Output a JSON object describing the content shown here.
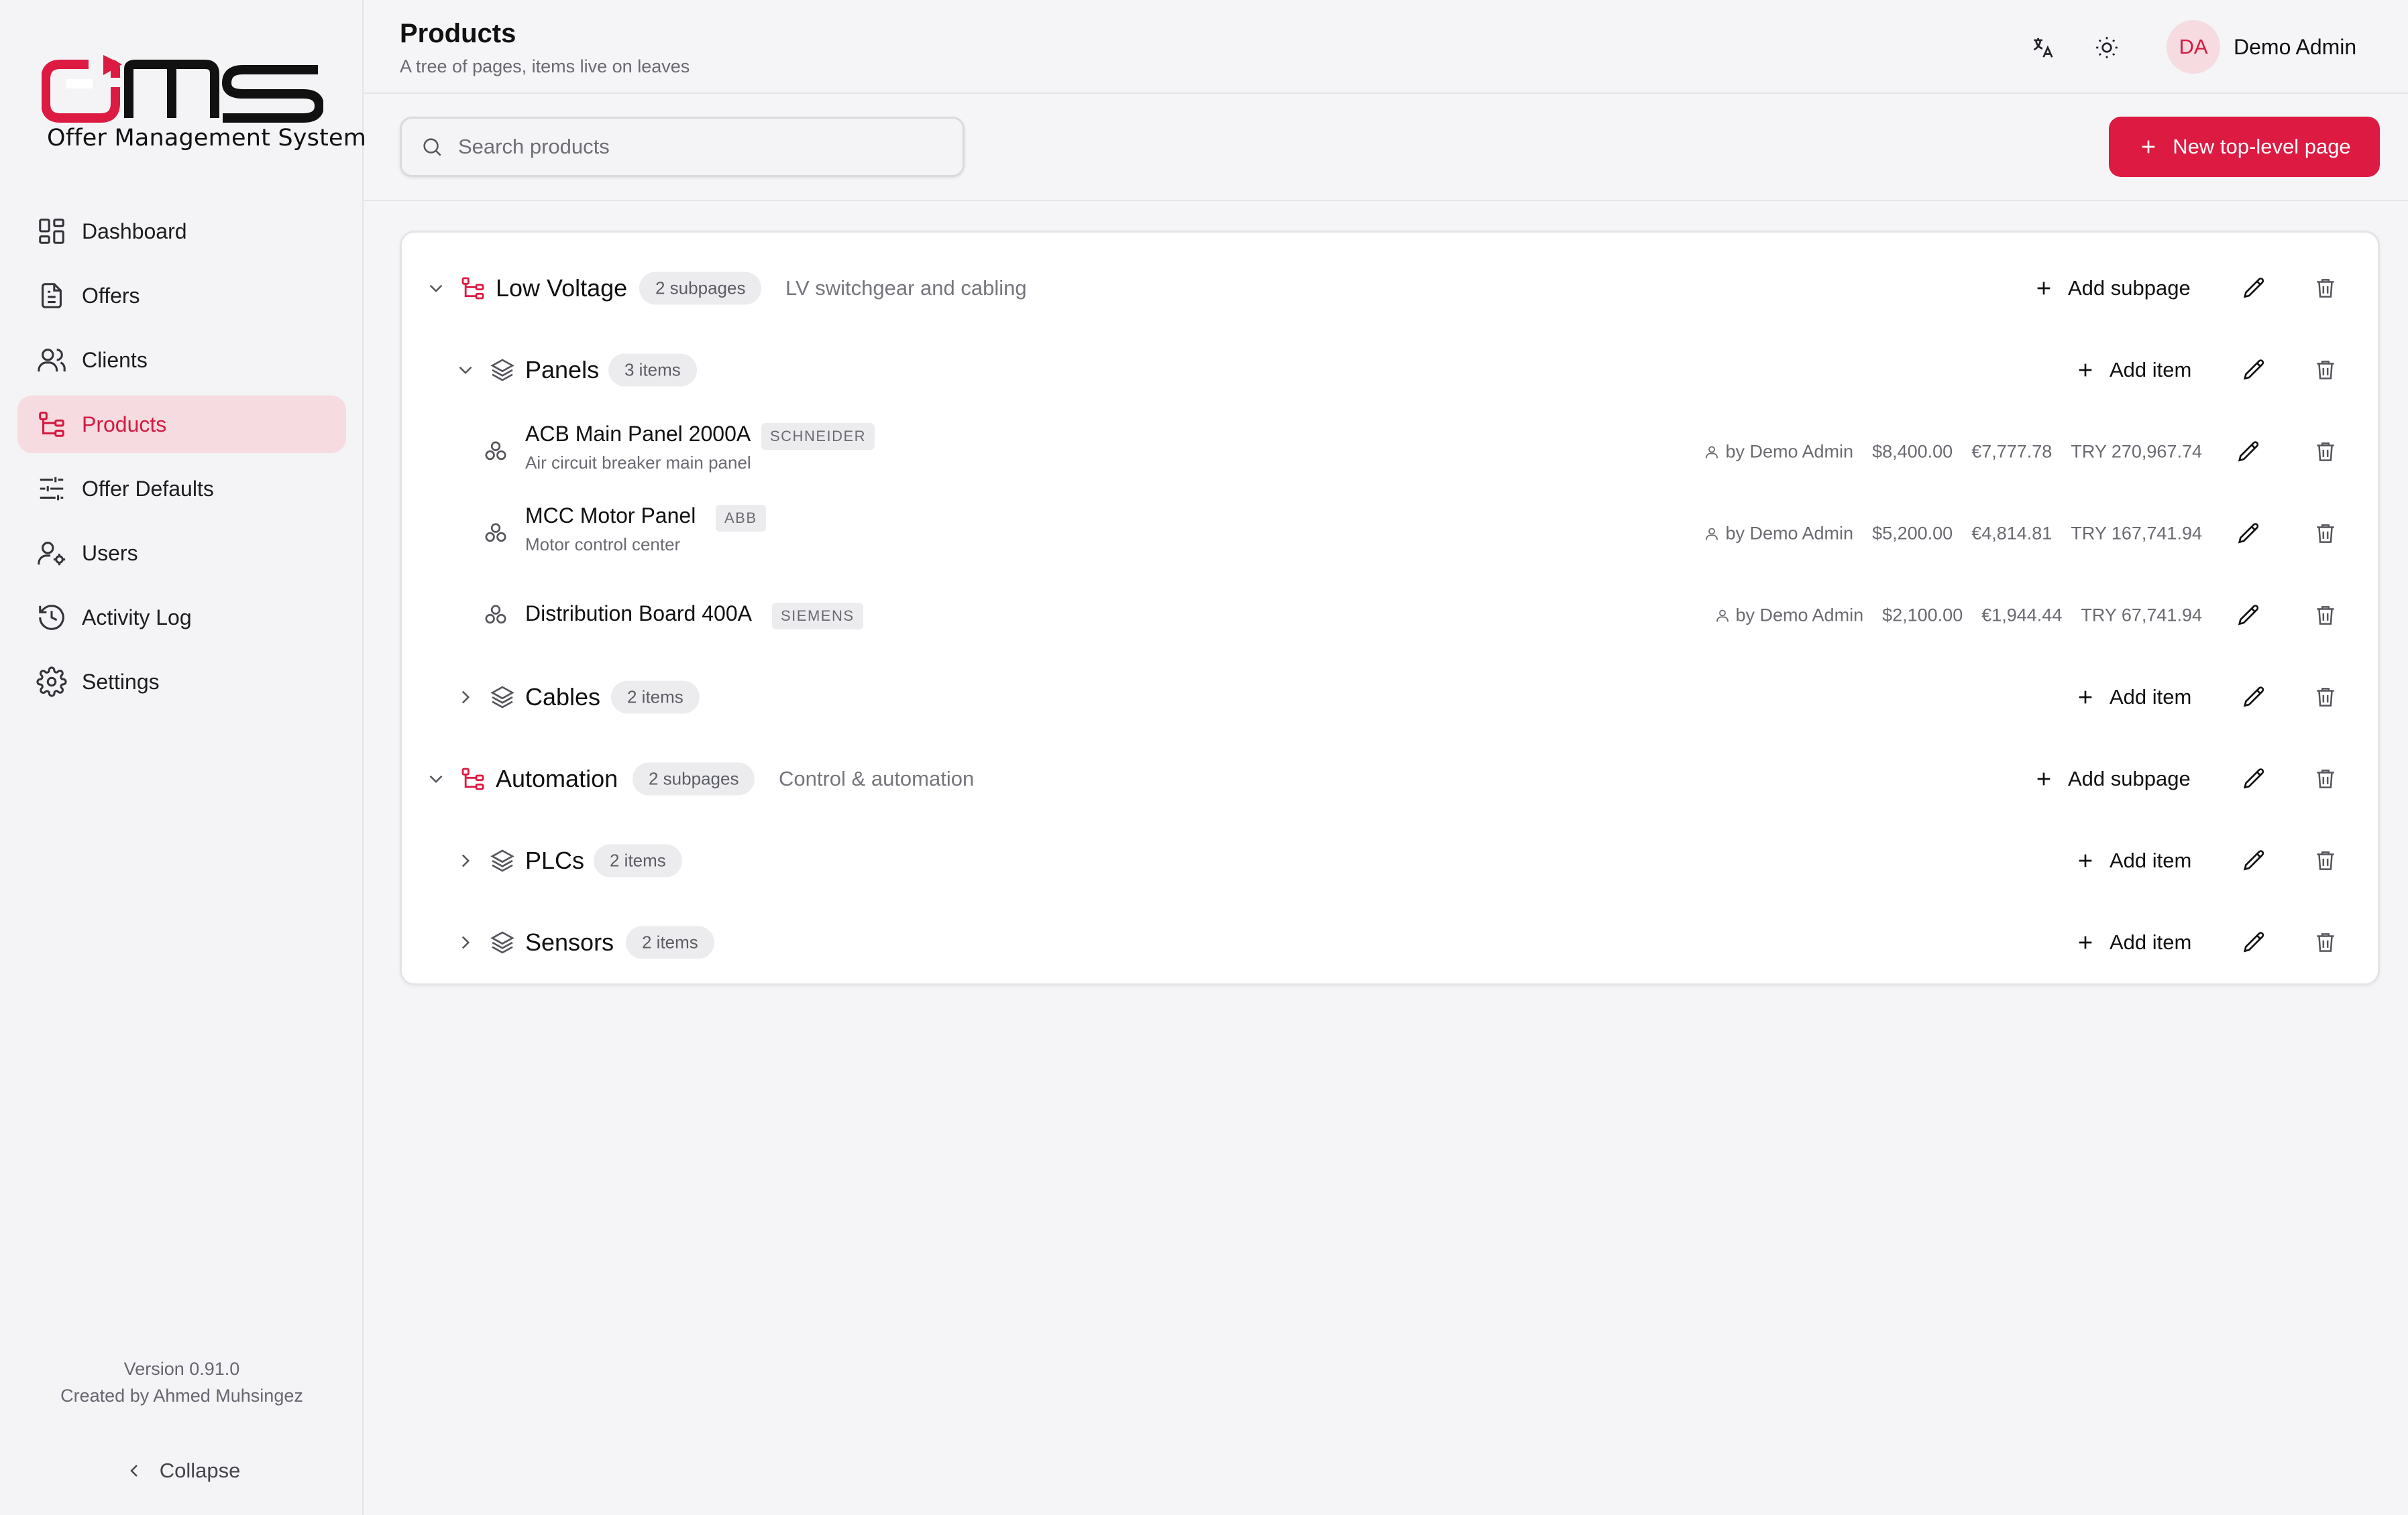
{
  "app": {
    "logo_text": "OMS",
    "logo_subtitle": "Offer Management System",
    "version": "Version 0.91.0",
    "credit": "Created by Ahmed Muhsingez",
    "collapse_label": "Collapse",
    "accent_color": "#dc1a42"
  },
  "sidebar": {
    "items": [
      {
        "label": "Dashboard",
        "icon": "dashboard-icon",
        "active": false
      },
      {
        "label": "Offers",
        "icon": "document-icon",
        "active": false
      },
      {
        "label": "Clients",
        "icon": "users-icon",
        "active": false
      },
      {
        "label": "Products",
        "icon": "tree-icon",
        "active": true
      },
      {
        "label": "Offer Defaults",
        "icon": "sliders-icon",
        "active": false
      },
      {
        "label": "Users",
        "icon": "user-cog-icon",
        "active": false
      },
      {
        "label": "Activity Log",
        "icon": "history-icon",
        "active": false
      },
      {
        "label": "Settings",
        "icon": "gear-icon",
        "active": false
      }
    ]
  },
  "header": {
    "title": "Products",
    "subtitle": "A tree of pages, items live on leaves",
    "user_initials": "DA",
    "user_name": "Demo Admin"
  },
  "toolbar": {
    "search_placeholder": "Search products",
    "new_button": "New top-level page"
  },
  "tree": {
    "pages": [
      {
        "name": "Low Voltage",
        "badge": "2 subpages",
        "description": "LV switchgear and cabling",
        "action": "Add subpage",
        "expanded": true,
        "children": [
          {
            "name": "Panels",
            "badge": "3 items",
            "action": "Add item",
            "expanded": true,
            "items": [
              {
                "name": "ACB Main Panel 2000A",
                "brand": "SCHNEIDER",
                "description": "Air circuit breaker main panel",
                "by": "by Demo Admin",
                "usd": "$8,400.00",
                "eur": "€7,777.78",
                "try": "TRY 270,967.74"
              },
              {
                "name": "MCC Motor Panel",
                "brand": "ABB",
                "description": "Motor control center",
                "by": "by Demo Admin",
                "usd": "$5,200.00",
                "eur": "€4,814.81",
                "try": "TRY 167,741.94"
              },
              {
                "name": "Distribution Board 400A",
                "brand": "SIEMENS",
                "description": "",
                "by": "by Demo Admin",
                "usd": "$2,100.00",
                "eur": "€1,944.44",
                "try": "TRY 67,741.94"
              }
            ]
          },
          {
            "name": "Cables",
            "badge": "2 items",
            "action": "Add item",
            "expanded": false
          }
        ]
      },
      {
        "name": "Automation",
        "badge": "2 subpages",
        "description": "Control & automation",
        "action": "Add subpage",
        "expanded": true,
        "children": [
          {
            "name": "PLCs",
            "badge": "2 items",
            "action": "Add item",
            "expanded": false
          },
          {
            "name": "Sensors",
            "badge": "2 items",
            "action": "Add item",
            "expanded": false
          }
        ]
      }
    ]
  }
}
